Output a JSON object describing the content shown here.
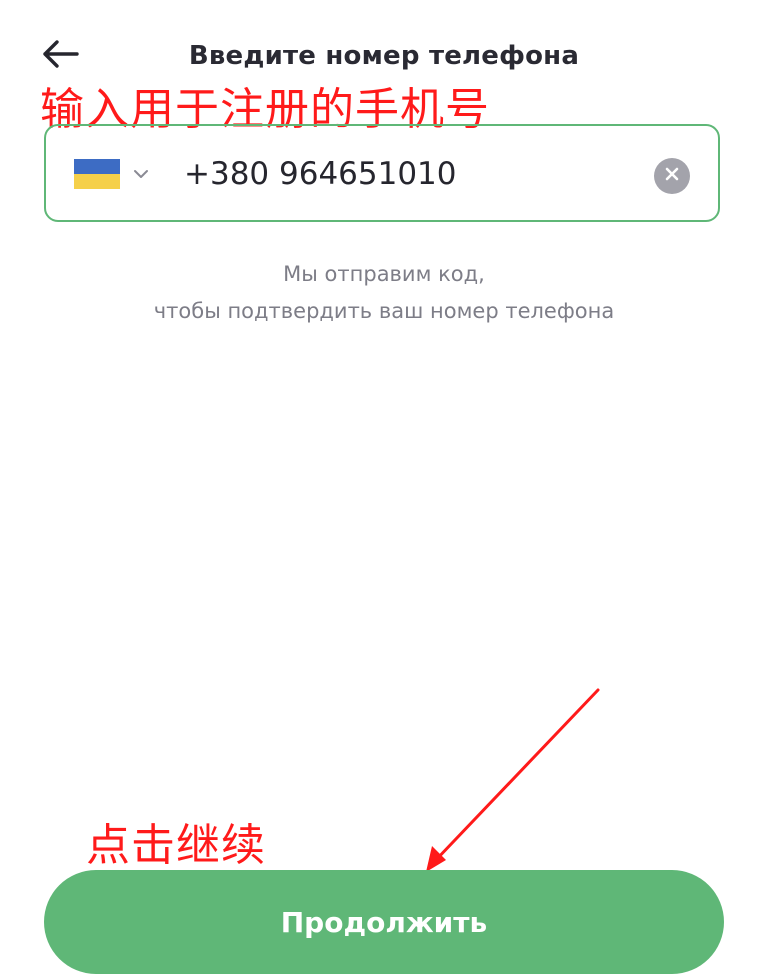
{
  "header": {
    "title": "Введите номер телефона",
    "back_icon": "arrow-left-icon"
  },
  "annotations": {
    "top": "输入用于注册的手机号",
    "bottom": "点击继续",
    "color": "#ff1a1a"
  },
  "phone_input": {
    "country": "Ukraine",
    "flag_colors": [
      "#3d6cc4",
      "#f5d04a"
    ],
    "chevron_icon": "chevron-down-icon",
    "value": "+380 964651010",
    "clear_icon": "close-icon",
    "border_color": "#5fb777"
  },
  "hint": {
    "line1": "Мы отправим код,",
    "line2": "чтобы подтвердить ваш номер телефона"
  },
  "continue_button": {
    "label": "Продолжить",
    "color": "#5fb777"
  }
}
